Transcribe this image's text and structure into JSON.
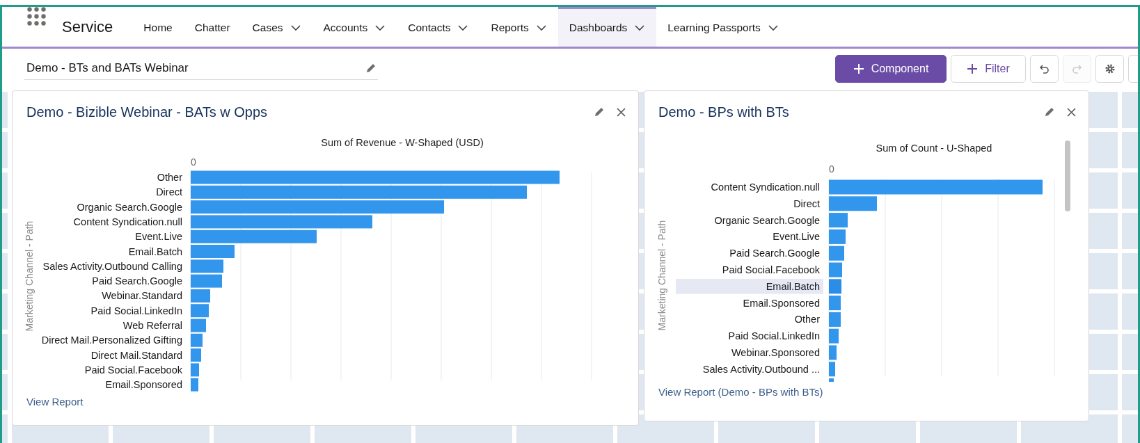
{
  "app": {
    "name": "Service"
  },
  "nav_tabs": [
    {
      "label": "Home",
      "selected": false,
      "has_menu": false
    },
    {
      "label": "Chatter",
      "selected": false,
      "has_menu": false
    },
    {
      "label": "Cases",
      "selected": false,
      "has_menu": true
    },
    {
      "label": "Accounts",
      "selected": false,
      "has_menu": true
    },
    {
      "label": "Contacts",
      "selected": false,
      "has_menu": true
    },
    {
      "label": "Reports",
      "selected": false,
      "has_menu": true
    },
    {
      "label": "Dashboards",
      "selected": true,
      "has_menu": true
    },
    {
      "label": "Learning Passports",
      "selected": false,
      "has_menu": true
    }
  ],
  "dashboard": {
    "title": "Demo - BTs and BATs Webinar"
  },
  "toolbar": {
    "buttons": [
      {
        "kind": "primary",
        "label": "Component"
      },
      {
        "kind": "outline",
        "label": "Filter"
      },
      {
        "kind": "undo",
        "disabled": false
      },
      {
        "kind": "redo",
        "disabled": true
      },
      {
        "kind": "settings",
        "disabled": false
      }
    ]
  },
  "components": [
    {
      "title": "Demo - Bizible Webinar - BATs w Opps",
      "link": "View Report",
      "chart": {
        "title": "Sum of Revenue - W-Shaped (USD)",
        "axis_label": "Marketing Channel - Path",
        "zero_tick": "0",
        "categories": [
          {
            "label": "Other",
            "selected": false
          },
          {
            "label": "Direct",
            "selected": false
          },
          {
            "label": "Organic Search.Google",
            "selected": false
          },
          {
            "label": "Content Syndication.null",
            "selected": false
          },
          {
            "label": "Event.Live",
            "selected": false
          },
          {
            "label": "Email.Batch",
            "selected": false
          },
          {
            "label": "Sales Activity.Outbound Calling",
            "selected": false
          },
          {
            "label": "Paid Search.Google",
            "selected": false
          },
          {
            "label": "Webinar.Standard",
            "selected": false
          },
          {
            "label": "Paid Social.LinkedIn",
            "selected": false
          },
          {
            "label": "Web Referral",
            "selected": false
          },
          {
            "label": "Direct Mail.Personalized Gifting",
            "selected": false
          },
          {
            "label": "Direct Mail.Standard",
            "selected": false
          },
          {
            "label": "Paid Social.Facebook",
            "selected": false
          },
          {
            "label": "Email.Sponsored",
            "selected": false
          }
        ]
      }
    },
    {
      "title": "Demo - BPs with BTs",
      "link": "View Report (Demo - BPs with BTs)",
      "chart": {
        "title": "Sum of Count - U-Shaped",
        "axis_label": "Marketing Channel - Path",
        "zero_tick": "0",
        "categories": [
          {
            "label": "Content Syndication.null",
            "selected": false
          },
          {
            "label": "Direct",
            "selected": false
          },
          {
            "label": "Organic Search.Google",
            "selected": false
          },
          {
            "label": "Event.Live",
            "selected": false
          },
          {
            "label": "Paid Search.Google",
            "selected": false
          },
          {
            "label": "Paid Social.Facebook",
            "selected": false
          },
          {
            "label": "Email.Batch",
            "selected": true
          },
          {
            "label": "Email.Sponsored",
            "selected": false
          },
          {
            "label": "Other",
            "selected": false
          },
          {
            "label": "Paid Social.LinkedIn",
            "selected": false
          },
          {
            "label": "Webinar.Sponsored",
            "selected": false
          },
          {
            "label": "Sales Activity.Outbound ...",
            "selected": false
          }
        ]
      }
    }
  ]
}
